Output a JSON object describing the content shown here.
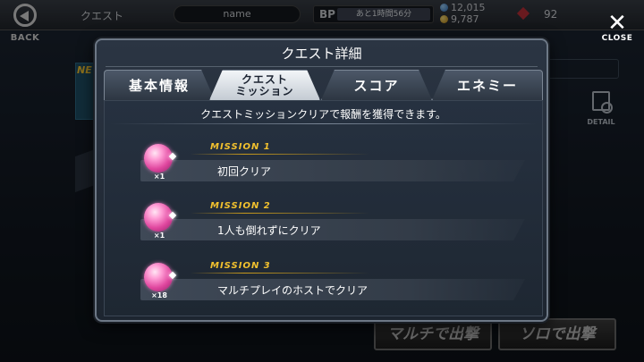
{
  "header": {
    "back_label": "BACK",
    "quest_label": "クエスト",
    "name_value": "name",
    "bp_label": "BP",
    "bp_time": "あと1時間56分",
    "currency_blue": "12,015",
    "currency_gold": "9,787",
    "gem_count": "92",
    "close_label": "CLOSE"
  },
  "background": {
    "detail_label": "DETAIL",
    "multi_button": "マルチで出撃",
    "solo_button": "ソロで出撃"
  },
  "modal": {
    "title": "クエスト詳細",
    "tabs": [
      {
        "label": "基本情報",
        "active": false
      },
      {
        "label": "クエスト",
        "label2": "ミッション",
        "active": true
      },
      {
        "label": "スコア",
        "active": false
      },
      {
        "label": "エネミー",
        "active": false
      }
    ],
    "intro": "クエストミッションクリアで報酬を獲得できます。",
    "missions": [
      {
        "heading": "MISSION 1",
        "text": "初回クリア",
        "reward_qty": "×1"
      },
      {
        "heading": "MISSION 2",
        "text": "1人も倒れずにクリア",
        "reward_qty": "×1"
      },
      {
        "heading": "MISSION 3",
        "text": "マルチプレイのホストでクリア",
        "reward_qty": "×18"
      }
    ]
  },
  "colors": {
    "mission_heading": "#f2c12e",
    "active_tab": "#e6eaef",
    "gem": "#e0479f"
  }
}
